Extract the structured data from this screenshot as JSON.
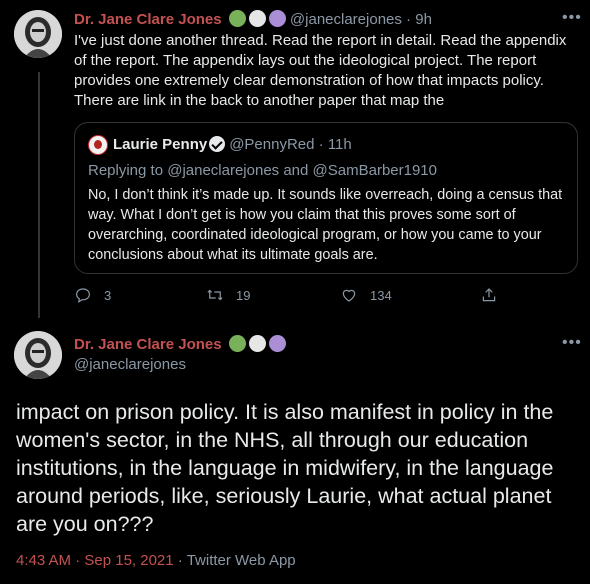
{
  "tweet1": {
    "author_name": "Dr. Jane Clare Jones",
    "emojis": [
      "green-heart",
      "white-heart",
      "purple-heart"
    ],
    "handle": "@janeclarejones",
    "separator": " · ",
    "age": "9h",
    "text": "I've just done another thread. Read the report in detail. Read the appendix of the report. The appendix lays out the ideological project. The report provides one extremely clear demonstration of how that impacts policy. There are link in the back to another paper that map the",
    "quote": {
      "author_name": "Laurie Penny",
      "handle": "@PennyRed",
      "separator": " · ",
      "age": "11h",
      "replying_to": "Replying to @janeclarejones and @SamBarber1910",
      "text": "No, I don’t think it’s made up. It sounds like overreach, doing a census that way. What I don’t get is how you claim that this proves some sort of overarching, coordinated ideological program, or how you came to your conclusions about what its ultimate   goals are."
    },
    "actions": {
      "replies": "3",
      "retweets": "19",
      "likes": "134"
    }
  },
  "tweet2": {
    "author_name": "Dr. Jane Clare Jones",
    "emojis": [
      "green-heart",
      "white-heart",
      "purple-heart"
    ],
    "handle": "@janeclarejones",
    "text": "impact on prison policy. It is also manifest in policy in the women's sector, in the NHS, all through our education institutions, in the language in midwifery, in the language around periods, like, seriously Laurie, what actual planet are you on???",
    "time": "4:43 AM · Sep 15, 2021",
    "separator": " · ",
    "app": "Twitter Web App"
  },
  "colors": {
    "background": "#000000",
    "name_accent": "#c45151",
    "secondary_text": "#8b98a5",
    "primary_text": "#e7e9ea",
    "border": "#2f3336"
  }
}
